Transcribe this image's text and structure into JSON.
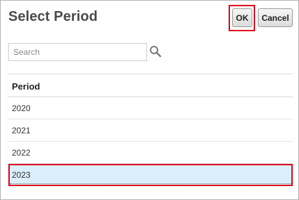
{
  "dialog": {
    "title": "Select Period",
    "ok_label": "OK",
    "cancel_label": "Cancel"
  },
  "search": {
    "placeholder": "Search",
    "value": ""
  },
  "table": {
    "column_header": "Period",
    "rows": [
      "2020",
      "2021",
      "2022",
      "2023"
    ],
    "selected_row": "2023"
  },
  "colors": {
    "highlight_border": "#e0001b",
    "selected_row_bg": "#dbeefc",
    "title_text": "#4a4a4a"
  }
}
